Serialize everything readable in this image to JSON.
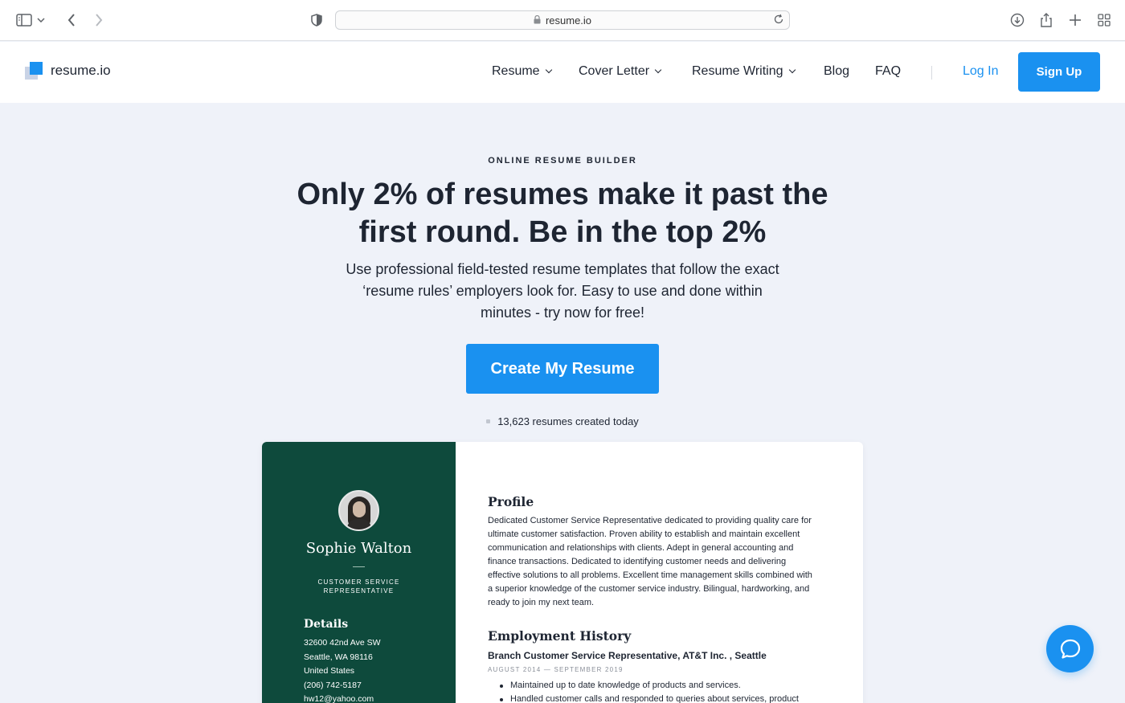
{
  "browser": {
    "url": "resume.io"
  },
  "header": {
    "logo_text": "resume.io",
    "nav": [
      {
        "label": "Resume",
        "has_dropdown": true
      },
      {
        "label": "Cover Letter",
        "has_dropdown": true
      },
      {
        "label": "Resume Writing",
        "has_dropdown": true
      },
      {
        "label": "Blog",
        "has_dropdown": false
      },
      {
        "label": "FAQ",
        "has_dropdown": false
      }
    ],
    "login": "Log In",
    "signup": "Sign Up"
  },
  "hero": {
    "eyebrow": "ONLINE RESUME BUILDER",
    "headline_line1": "Only 2% of resumes make it past the",
    "headline_line2": "first round. Be in the top 2%",
    "subtext_line1": "Use professional field-tested resume templates that follow the exact",
    "subtext_line2": "‘resume rules’ employers look for. Easy to use and done within",
    "subtext_line3": "minutes - try now for free!",
    "cta": "Create My Resume",
    "counter": "13,623 resumes created today"
  },
  "resume_preview": {
    "name": "Sophie Walton",
    "title_line1": "CUSTOMER SERVICE",
    "title_line2": "REPRESENTATIVE",
    "details_heading": "Details",
    "details": [
      "32600 42nd Ave SW",
      "Seattle, WA 98116",
      "United States",
      "(206) 742-5187",
      "hw12@yahoo.com"
    ],
    "profile_heading": "Profile",
    "profile_lines": [
      "Dedicated Customer Service Representative dedicated to providing quality care for",
      "ultimate customer satisfaction. Proven ability to establish and maintain excellent",
      "communication and relationships with clients. Adept in general accounting and",
      "finance transactions. Dedicated to identifying customer needs and delivering",
      "effective solutions to all problems. Excellent time management skills combined with",
      "a superior knowledge of the customer service industry. Bilingual, hardworking, and",
      "ready to join my next team."
    ],
    "employment_heading": "Employment History",
    "job_title": "Branch Customer Service Representative, AT&T Inc. , Seattle",
    "job_dates": "AUGUST 2014 — SEPTEMBER 2019",
    "job_bullets": [
      "Maintained up to date knowledge of products and services.",
      "Handled customer calls and responded to queries about services, product"
    ]
  },
  "colors": {
    "accent": "#1a91f0",
    "resume_sidebar": "#0e4a3c",
    "page_bg": "#eff2f9"
  }
}
